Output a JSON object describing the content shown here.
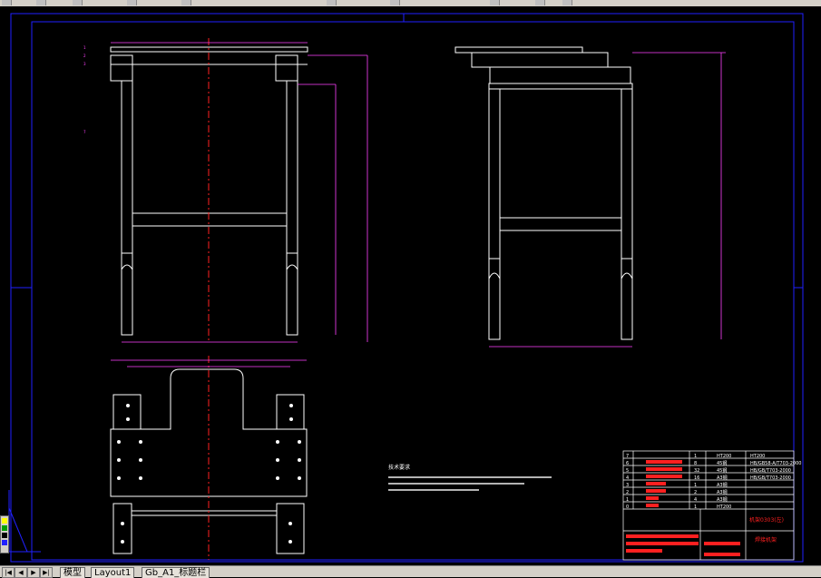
{
  "tabs": {
    "model": "模型",
    "layout1": "Layout1",
    "gb_a1": "Gb_A1_标题栏"
  },
  "drawing": {
    "notes_title": "技术要求",
    "title_red_1": "机架0303(左)",
    "title_red_2": "焊接机架",
    "bom_header_1": "HT200",
    "bom_rows": [
      {
        "no": "7",
        "name": "",
        "qty": "1",
        "mat": "HT200",
        "std": "",
        "color": "#ff2020"
      },
      {
        "no": "6",
        "name": "",
        "qty": "8",
        "mat": "45钢",
        "std": "",
        "color": "#ff2020"
      },
      {
        "no": "5",
        "name": "",
        "qty": "32",
        "mat": "45钢",
        "std": "",
        "color": "#ff2020"
      },
      {
        "no": "4",
        "name": "",
        "qty": "16",
        "mat": "A3钢",
        "std": "",
        "color": "#ff2020"
      },
      {
        "no": "3",
        "name": "",
        "qty": "1",
        "mat": "A3钢",
        "std": "",
        "color": "#ff2020"
      },
      {
        "no": "2",
        "name": "",
        "qty": "2",
        "mat": "A3钢",
        "std": "",
        "color": "#ff2020"
      },
      {
        "no": "1",
        "name": "",
        "qty": "4",
        "mat": "A3钢",
        "std": "",
        "color": "#ff2020"
      },
      {
        "no": "0",
        "name": "",
        "qty": "1",
        "mat": "HT200",
        "std": "",
        "color": "#ff2020"
      }
    ]
  },
  "colors": {
    "frame": "#2020ff",
    "lines": "#ffffff",
    "dims": "#ff40ff",
    "center": "#ff2020",
    "accent": "#ff2020"
  }
}
